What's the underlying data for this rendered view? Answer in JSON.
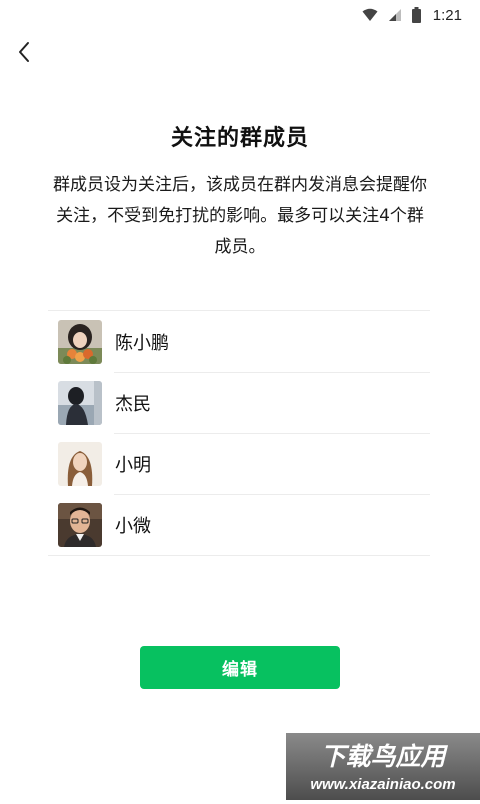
{
  "status_bar": {
    "time": "1:21"
  },
  "page": {
    "title": "关注的群成员",
    "description": "群成员设为关注后，该成员在群内发消息会提醒你关注，不受到免打扰的影响。最多可以关注4个群成员。"
  },
  "members": [
    {
      "name": "陈小鹏"
    },
    {
      "name": "杰民"
    },
    {
      "name": "小明"
    },
    {
      "name": "小微"
    }
  ],
  "actions": {
    "edit_label": "编辑"
  },
  "watermark": {
    "title": "下载鸟应用",
    "url": "www.xiazainiao.com"
  },
  "colors": {
    "primary_green": "#07c160",
    "divider": "#ececec",
    "text_primary": "#111111"
  },
  "icons": {
    "back": "back-arrow-icon",
    "wifi": "wifi-icon",
    "signal": "signal-icon",
    "battery": "battery-icon"
  }
}
